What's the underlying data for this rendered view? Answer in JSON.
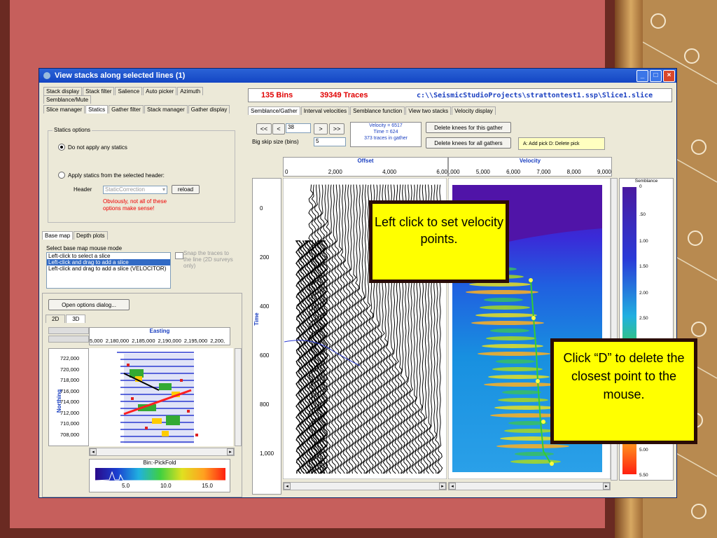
{
  "window": {
    "title": "View stacks along selected lines    (1)",
    "buttons": [
      "_",
      "□",
      "×"
    ]
  },
  "left": {
    "tabs_row1": [
      "Stack display",
      "Stack filter",
      "Salience",
      "Auto picker",
      "Azimuth",
      "Semblance/Mute"
    ],
    "tabs_row2": [
      "Slice manager",
      "Statics",
      "Gather filter",
      "Stack manager",
      "Gather display"
    ],
    "active_tab": "Statics",
    "statics_group_title": "Statics options",
    "radio_no_statics": "Do not apply any statics",
    "radio_apply_statics": "Apply statics from the selected header:",
    "header_label": "Header",
    "header_select_value": "StaticCorrection",
    "reload_button": "reload",
    "warning": "Obviously, not all of these options make sense!",
    "lower_tabs": [
      "Base map",
      "Depth plots"
    ],
    "basemap_mode_label": "Select base map mouse mode",
    "basemap_modes": [
      "Left-click to select a slice",
      "Left-click and drag to add a slice",
      "Left-click and drag to add a slice (VELOCITOR)"
    ],
    "snap_checkbox": "Snap the traces to the line (2D surveys only)",
    "open_options_button": "Open options dialog...",
    "view_tabs": [
      "2D",
      "3D"
    ],
    "easting_label": "Easting",
    "easting_ticks": [
      "5,000",
      "2,180,000",
      "2,185,000",
      "2,190,000",
      "2,195,000",
      "2,200,"
    ],
    "northing_label": "Northing",
    "northing_ticks": [
      "722,000",
      "720,000",
      "718,000",
      "716,000",
      "714,000",
      "712,000",
      "710,000",
      "708,000",
      "706,000"
    ],
    "colorbar_title": "Bin:-PickFold",
    "colorbar_ticks": [
      "5.0",
      "10.0",
      "15.0"
    ]
  },
  "right": {
    "bins": "135 Bins",
    "traces": "39349 Traces",
    "path": "c:\\\\SeismicStudioProjects\\strattontest1.ssp\\Slice1.slice",
    "tabs": [
      "Semblance/Gather",
      "Interval velocities",
      "Semblance function",
      "View two stacks",
      "Velocity display"
    ],
    "active_tab": "Semblance/Gather",
    "nav_buttons": [
      "<<",
      "<",
      ">",
      ">>"
    ],
    "gather_number": "38",
    "big_skip_label": "Big skip size (bins)",
    "big_skip_value": "5",
    "velocity_info": "Velocity = 6517",
    "time_info": "Time = 624",
    "traces_in_gather": "373  traces in gather",
    "delete_knees_gather": "Delete knees for this gather",
    "delete_knees_all": "Delete knees for all gathers",
    "pick_hint": "A: Add pick   D: Delete pick",
    "offset_label": "Offset",
    "offset_ticks": [
      "0",
      "2,000",
      "4,000",
      "6,00"
    ],
    "velocity_label": "Velocity",
    "velocity_ticks": [
      ",000",
      "5,000",
      "6,000",
      "7,000",
      "8,000",
      "9,000"
    ],
    "time_label": "Time",
    "time_ticks": [
      "0",
      "200",
      "400",
      "600",
      "800",
      "1,000"
    ],
    "semblance_label": "Semblance",
    "semblance_ticks": [
      "0",
      ".50",
      "1.00",
      "1.50",
      "2.00",
      "2.50",
      "5.00",
      "5.50"
    ]
  },
  "callouts": {
    "left_click": "Left click to set velocity points.",
    "click_d": "Click “D” to delete the closest point to the mouse."
  },
  "colors": {
    "slide_bg": "#c65f5c",
    "titlebar": "#1f55cf",
    "callout_bg": "#ffff00",
    "bins_text": "#e00000",
    "semblance_deep": "#4a1aa0",
    "pick_line": "#33cc33"
  }
}
